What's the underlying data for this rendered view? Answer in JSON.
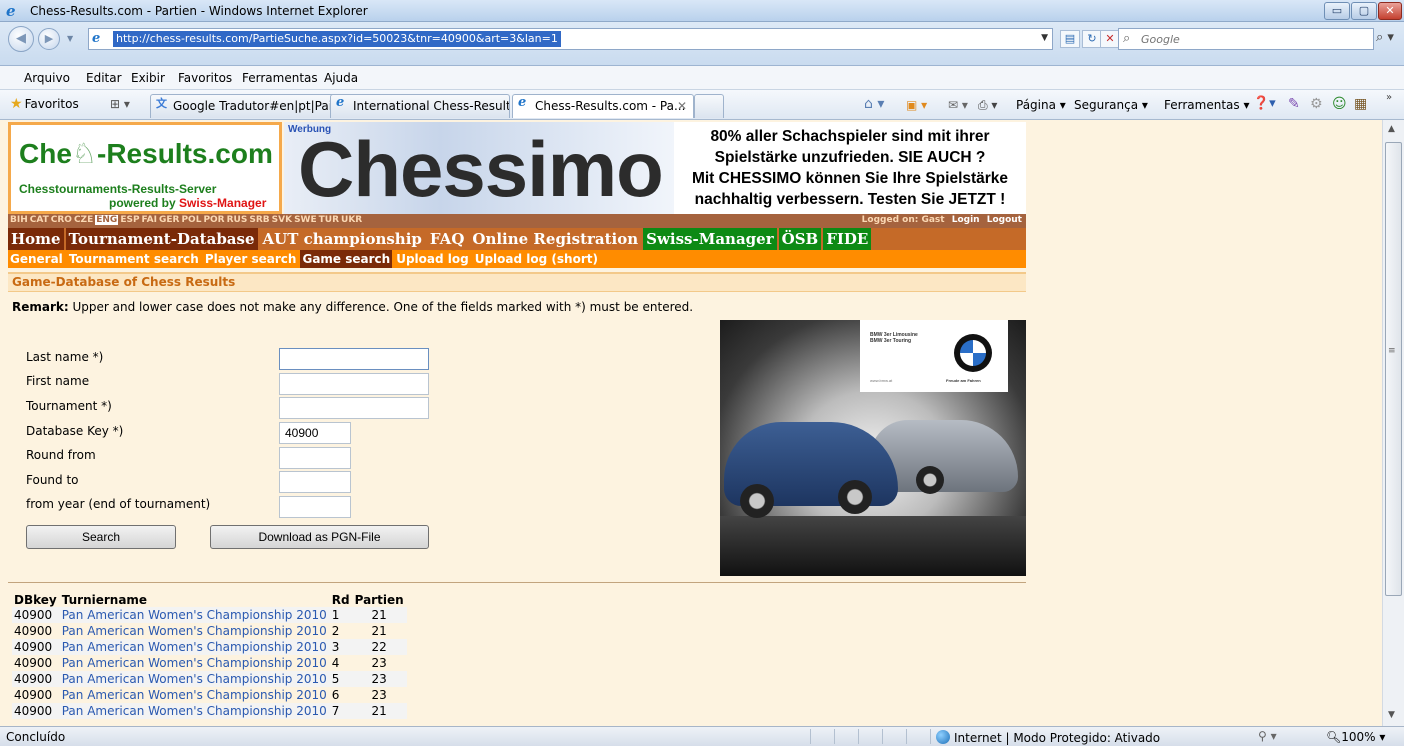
{
  "window": {
    "title": "Chess-Results.com - Partien - Windows Internet Explorer",
    "minimize": "▭",
    "maximize": "▢",
    "close": "✕"
  },
  "address": {
    "url": "http://chess-results.com/PartieSuche.aspx?id=50023&tnr=40900&art=3&lan=1",
    "search_placeholder": "Google"
  },
  "menu": [
    "Arquivo",
    "Editar",
    "Exibir",
    "Favoritos",
    "Ferramentas",
    "Ajuda"
  ],
  "favorites": {
    "label": "Favoritos",
    "tabs": [
      {
        "label": "Google Tradutor#en|pt|Pai..."
      },
      {
        "label": "International Chess-Result..."
      },
      {
        "label": "Chess-Results.com - Pa..."
      }
    ],
    "commands": [
      "Página ▾",
      "Segurança ▾",
      "Ferramentas ▾"
    ]
  },
  "header": {
    "logo_title_a": "Che",
    "logo_title_b": "-Results.com",
    "logo_sub1": "Chesstournaments-Results-Server",
    "logo_sub2_a": "powered by ",
    "logo_sub2_b": "Swiss-Manager",
    "banner_label": "Werbung",
    "banner_brand": "Chessimo",
    "banner_text": [
      "80% aller Schachspieler sind mit ihrer",
      "Spielstärke unzufrieden. SIE AUCH ?",
      "Mit CHESSIMO können Sie Ihre Spielstärke",
      "nachhaltig verbessern. Testen Sie JETZT !"
    ]
  },
  "languages": [
    "BIH",
    "CAT",
    "CRO",
    "CZE",
    "ENG",
    "ESP",
    "FAI",
    "GER",
    "POL",
    "POR",
    "RUS",
    "SRB",
    "SVK",
    "SWE",
    "TUR",
    "UKR"
  ],
  "current_language": "ENG",
  "login": {
    "status": "Logged on: Gast",
    "login": "Login",
    "logout": "Logout"
  },
  "main_nav": [
    {
      "label": "Home",
      "style": "dark"
    },
    {
      "label": "Tournament-Database",
      "style": "dark"
    },
    {
      "label": "AUT championship",
      "style": "plain"
    },
    {
      "label": "FAQ",
      "style": "plain"
    },
    {
      "label": "Online Registration",
      "style": "plain"
    },
    {
      "label": "Swiss-Manager",
      "style": "green"
    },
    {
      "label": "ÖSB",
      "style": "green"
    },
    {
      "label": "FIDE",
      "style": "green"
    }
  ],
  "sub_nav": [
    {
      "label": "General",
      "active": false
    },
    {
      "label": "Tournament search",
      "active": false
    },
    {
      "label": "Player search",
      "active": false
    },
    {
      "label": "Game search",
      "active": true
    },
    {
      "label": "Upload log",
      "active": false
    },
    {
      "label": "Upload log (short)",
      "active": false
    }
  ],
  "page": {
    "heading": "Game-Database of Chess Results",
    "remark_label": "Remark:",
    "remark_text": " Upper and lower case does not make any difference. One of the fields marked with *) must be entered."
  },
  "form": {
    "fields": [
      {
        "label": "Last name *)",
        "value": ""
      },
      {
        "label": "First name",
        "value": ""
      },
      {
        "label": "Tournament *)",
        "value": ""
      },
      {
        "label": "Database Key *)",
        "value": "40900"
      },
      {
        "label": "Round from",
        "value": ""
      },
      {
        "label": "Found to",
        "value": ""
      },
      {
        "label": "from year (end of tournament)",
        "value": ""
      }
    ],
    "search_button": "Search",
    "download_button": "Download as PGN-File"
  },
  "ad": {
    "lines": "BMW 3er Limousine\nBMW 3er Touring",
    "url": "www.bmw.at",
    "slogan": "Freude am Fahren"
  },
  "results": {
    "columns": [
      "DBkey",
      "Turniername",
      "Rd",
      "Partien"
    ],
    "rows": [
      [
        "40900",
        "Pan American Women's Championship 2010",
        "1",
        "21"
      ],
      [
        "40900",
        "Pan American Women's Championship 2010",
        "2",
        "21"
      ],
      [
        "40900",
        "Pan American Women's Championship 2010",
        "3",
        "22"
      ],
      [
        "40900",
        "Pan American Women's Championship 2010",
        "4",
        "23"
      ],
      [
        "40900",
        "Pan American Women's Championship 2010",
        "5",
        "23"
      ],
      [
        "40900",
        "Pan American Women's Championship 2010",
        "6",
        "23"
      ],
      [
        "40900",
        "Pan American Women's Championship 2010",
        "7",
        "21"
      ]
    ]
  },
  "status": {
    "left": "Concluído",
    "zone": "Internet | Modo Protegido: Ativado",
    "zoom": "100%"
  },
  "colors": {
    "accent_orange": "#ff8c00",
    "nav_brown": "#c56a28",
    "nav_dark": "#7a2a08",
    "nav_green": "#0d8a14",
    "link_blue": "#2a59b0",
    "page_bg": "#fdf3e0"
  }
}
